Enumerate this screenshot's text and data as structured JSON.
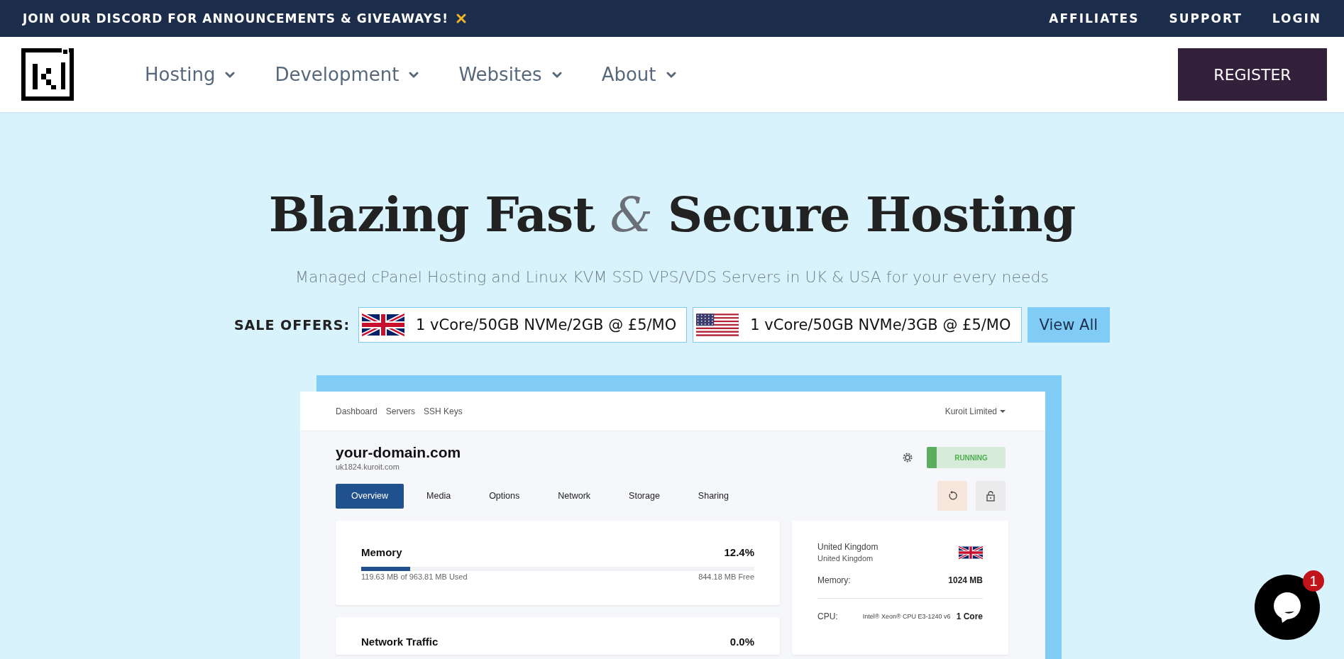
{
  "announcement": {
    "text": "JOIN OUR DISCORD FOR ANNOUNCEMENTS & GIVEAWAYS!"
  },
  "top_links": [
    "AFFILIATES",
    "SUPPORT",
    "LOGIN"
  ],
  "nav": {
    "items": [
      {
        "label": "Hosting"
      },
      {
        "label": "Development"
      },
      {
        "label": "Websites"
      },
      {
        "label": "About"
      }
    ],
    "register": "REGISTER"
  },
  "hero": {
    "title_start": "Blazing Fast",
    "ampersand": "&",
    "title_end": "Secure Hosting",
    "subtitle": "Managed cPanel Hosting and Linux KVM SSD VPS/VDS Servers in UK & USA for your every needs"
  },
  "sale_offers": {
    "label": "SALE OFFERS:",
    "offers": [
      {
        "kind": "uk",
        "text": "1 vCore/50GB NVMe/2GB @ £5/MO"
      },
      {
        "kind": "us",
        "text": "1 vCore/50GB NVMe/3GB @ £5/MO"
      }
    ],
    "view_all": "View All"
  },
  "dashboard": {
    "nav_links": [
      "Dashboard",
      "Servers",
      "SSH Keys"
    ],
    "account": "Kuroit Limited",
    "domain": "your-domain.com",
    "hostname": "uk1824.kuroit.com",
    "status": "RUNNING",
    "tabs": [
      {
        "label": "Overview",
        "selected": true
      },
      {
        "label": "Media",
        "selected": false
      },
      {
        "label": "Options",
        "selected": false
      },
      {
        "label": "Network",
        "selected": false
      },
      {
        "label": "Storage",
        "selected": false
      },
      {
        "label": "Sharing",
        "selected": false
      }
    ],
    "memory": {
      "title": "Memory",
      "percent": "12.4%",
      "level": 0.124,
      "used": "119.63 MB of 963.81 MB Used",
      "free": "844.18 MB Free"
    },
    "traffic": {
      "title": "Network Traffic",
      "percent": "0.0%"
    },
    "location": {
      "kind": "uk",
      "country": "United Kingdom",
      "region": "United Kingdom"
    },
    "specs": [
      {
        "label": "Memory:",
        "value": "1024 MB"
      },
      {
        "label": "CPU:",
        "detail": "Intel® Xeon® CPU E3-1240 v6",
        "value": "1 Core"
      }
    ]
  },
  "chat": {
    "badge": "1"
  }
}
